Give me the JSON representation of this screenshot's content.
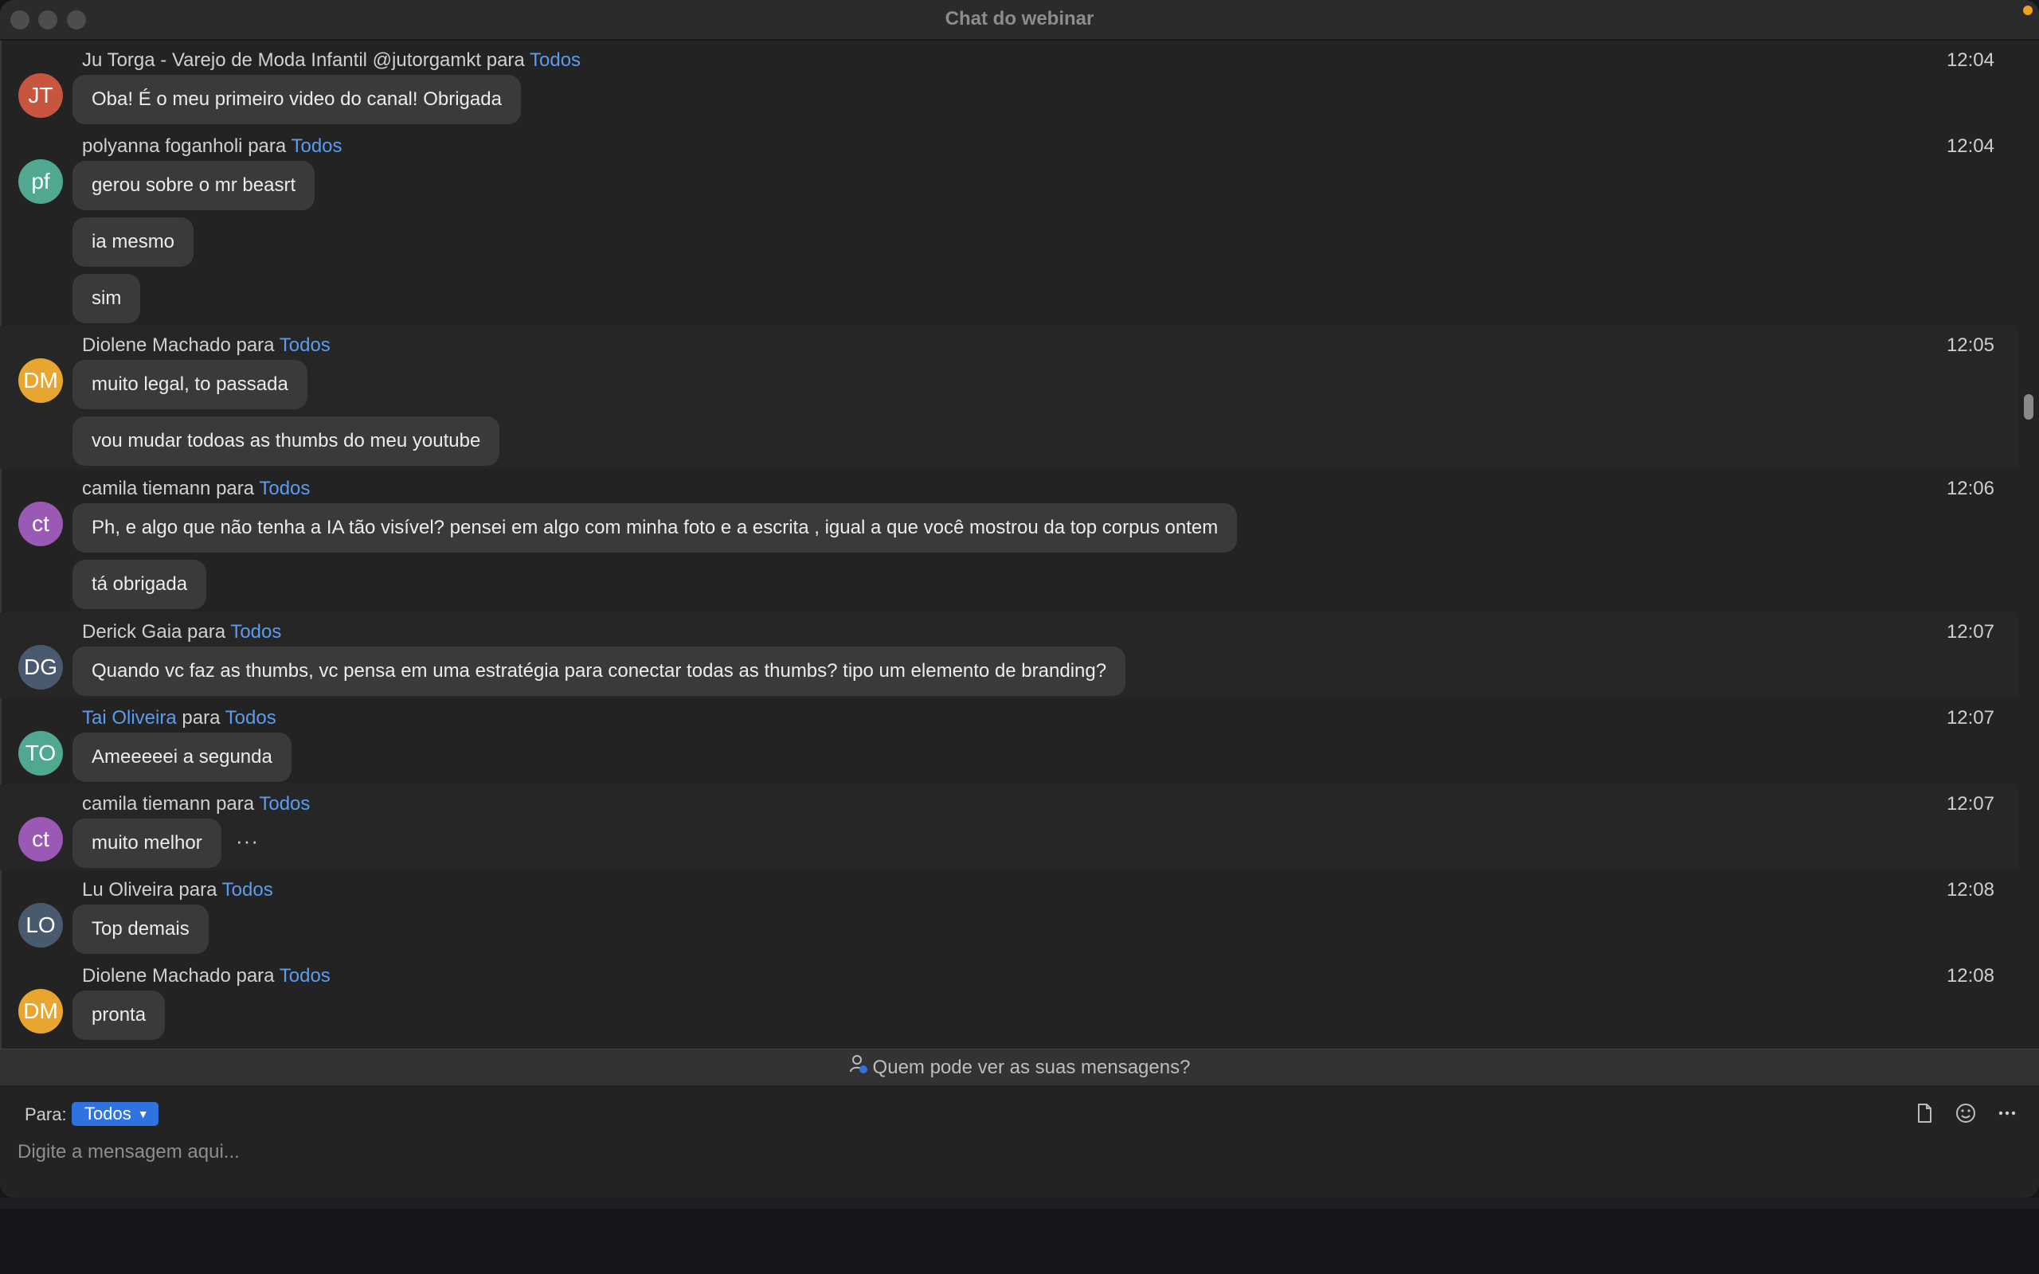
{
  "window": {
    "title": "Chat do webinar"
  },
  "recipient_word": "para",
  "messages": [
    {
      "sender": "Ju Torga - Varejo de Moda Infantil @jutorgamkt",
      "to": "Todos",
      "time": "12:04",
      "initials": "JT",
      "avatar_color": "#c8553d",
      "bubbles": [
        "Oba! É o meu primeiro video do canal! Obrigada"
      ]
    },
    {
      "sender": "polyanna foganholi",
      "to": "Todos",
      "time": "12:04",
      "initials": "pf",
      "avatar_color": "#4fa88f",
      "bubbles": [
        "gerou sobre o mr beasrt",
        "ia mesmo",
        "sim"
      ]
    },
    {
      "sender": "Diolene Machado",
      "to": "Todos",
      "time": "12:05",
      "initials": "DM",
      "avatar_color": "#e8a631",
      "bubbles": [
        "muito legal, to passada",
        "vou mudar todoas as thumbs do meu youtube"
      ]
    },
    {
      "sender": "camila tiemann",
      "to": "Todos",
      "time": "12:06",
      "initials": "ct",
      "avatar_color": "#9b59b6",
      "bubbles": [
        "Ph, e algo que não tenha a IA tão visível? pensei em algo com minha foto e a escrita , igual a que você mostrou da top corpus ontem",
        "tá obrigada"
      ]
    },
    {
      "sender": "Derick Gaia",
      "to": "Todos",
      "time": "12:07",
      "initials": "DG",
      "avatar_color": "#4a5a6e",
      "bubbles": [
        "Quando vc faz as thumbs, vc pensa em uma  estratégia para conectar todas as thumbs? tipo um elemento de branding?"
      ]
    },
    {
      "sender": "Tai Oliveira",
      "to": "Todos",
      "time": "12:07",
      "initials": "TO",
      "avatar_color": "#4fa88f",
      "bubbles": [
        "Ameeeeei a segunda"
      ]
    },
    {
      "sender": "camila tiemann",
      "to": "Todos",
      "time": "12:07",
      "initials": "ct",
      "avatar_color": "#9b59b6",
      "bubbles": [
        "muito melhor"
      ],
      "more": "···"
    },
    {
      "sender": "Lu Oliveira",
      "to": "Todos",
      "time": "12:08",
      "initials": "LO",
      "avatar_color": "#4a5a6e",
      "bubbles": [
        "Top demais"
      ]
    },
    {
      "sender": "Diolene Machado",
      "to": "Todos",
      "time": "12:08",
      "initials": "DM",
      "avatar_color": "#e8a631",
      "bubbles": [
        "pronta"
      ]
    }
  ],
  "privacy": {
    "label": "Quem pode ver as suas mensagens?"
  },
  "composer": {
    "para_label": "Para:",
    "recipient": "Todos",
    "placeholder": "Digite a mensagem aqui...",
    "icons": [
      "file-icon",
      "emoji-icon",
      "more-icon"
    ]
  }
}
